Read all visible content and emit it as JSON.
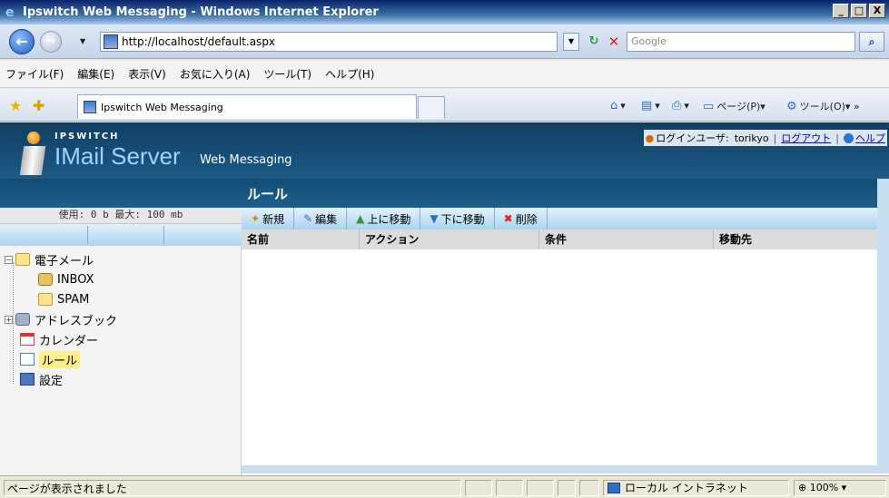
{
  "window": {
    "title": "Ipswitch Web Messaging - Windows Internet Explorer",
    "minimize": "_",
    "maximize": "□",
    "close": "X"
  },
  "address": {
    "url": "http://localhost/default.aspx",
    "search_placeholder": "Google"
  },
  "menu": [
    "ファイル(F)",
    "編集(E)",
    "表示(V)",
    "お気に入り(A)",
    "ツール(T)",
    "ヘルプ(H)"
  ],
  "favbar": {
    "tab_label": "Ipswitch Web Messaging",
    "page_label": "ページ(P)",
    "tools_label": "ツール(O)"
  },
  "header": {
    "brand": "IPSWITCH",
    "product": "IMail Server",
    "subtitle": "Web Messaging",
    "login_label": "ログインユーザ:",
    "username": "torikyo",
    "logout": "ログアウト",
    "help": "ヘルプ"
  },
  "sidebar": {
    "quota": "使用: 0 b 最大: 100 mb",
    "tree": [
      {
        "label": "電子メール",
        "icon": "folder-icon"
      },
      {
        "label": "INBOX",
        "icon": "inbox-icon"
      },
      {
        "label": "SPAM",
        "icon": "folder-icon"
      },
      {
        "label": "アドレスブック",
        "icon": "address-book-icon"
      },
      {
        "label": "カレンダー",
        "icon": "calendar-icon"
      },
      {
        "label": "ルール",
        "icon": "rule-icon",
        "selected": true
      },
      {
        "label": "設定",
        "icon": "settings-icon"
      }
    ]
  },
  "main": {
    "title": "ルール",
    "toolbar": [
      {
        "label": "新規",
        "icon": "new-icon"
      },
      {
        "label": "編集",
        "icon": "edit-icon"
      },
      {
        "label": "上に移動",
        "icon": "move-up-icon"
      },
      {
        "label": "下に移動",
        "icon": "move-down-icon"
      },
      {
        "label": "削除",
        "icon": "delete-icon"
      }
    ],
    "columns": [
      "名前",
      "アクション",
      "条件",
      "移動先"
    ]
  },
  "status": {
    "text": "ページが表示されました",
    "zone": "ローカル イントラネット",
    "zoom": "100%"
  },
  "colors": {
    "banner": "#134c74",
    "toolbar": "#a9d3ee",
    "selected": "#ffef8c"
  }
}
